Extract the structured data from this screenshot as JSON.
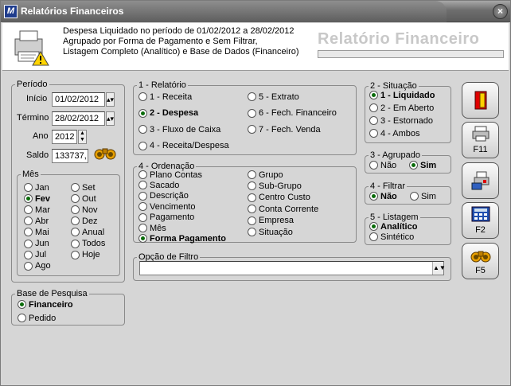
{
  "window": {
    "title": "Relatórios Financeiros",
    "close_label": "×",
    "icon_label": "M"
  },
  "header": {
    "line1": "Despesa Liquidado no período de 01/02/2012 a 28/02/2012",
    "line2": "Agrupado por Forma de Pagamento  e Sem Filtrar,",
    "line3": "Listagem Completo (Analítico) e Base de Dados (Financeiro)",
    "big_title": "Relatório Financeiro"
  },
  "periodo": {
    "legend": "Período",
    "inicio_label": "Início",
    "inicio_value": "01/02/2012",
    "termino_label": "Término",
    "termino_value": "28/02/2012",
    "ano_label": "Ano",
    "ano_value": "2012",
    "saldo_label": "Saldo",
    "saldo_value": "133737,"
  },
  "mes": {
    "legend": "Mês",
    "col1": [
      "Jan",
      "Fev",
      "Mar",
      "Abr",
      "Mai",
      "Jun",
      "Jul",
      "Ago"
    ],
    "col2": [
      "Set",
      "Out",
      "Nov",
      "Dez",
      "Anual",
      "Todos",
      "Hoje"
    ],
    "selected": "Fev"
  },
  "base": {
    "legend": "Base de Pesquisa",
    "options": [
      "Financeiro",
      "Pedido"
    ],
    "selected": "Financeiro"
  },
  "relatorio": {
    "legend": "1 - Relatório",
    "col1": [
      "1 - Receita",
      "2 - Despesa",
      "3 - Fluxo de Caixa",
      "4 - Receita/Despesa"
    ],
    "col2": [
      "5 - Extrato",
      "6 - Fech. Financeiro",
      "7 - Fech. Venda"
    ],
    "selected": "2 - Despesa"
  },
  "ordenacao": {
    "legend": "4 - Ordenação",
    "col1": [
      "Plano Contas",
      "Sacado",
      "Descrição",
      "Vencimento",
      "Pagamento",
      "Mês",
      "Forma Pagamento"
    ],
    "col2": [
      "Grupo",
      "Sub-Grupo",
      "Centro Custo",
      "Conta Corrente",
      "Empresa",
      "Situação"
    ],
    "selected": "Forma Pagamento"
  },
  "filtro": {
    "legend": "Opção de Filtro",
    "value": ""
  },
  "situacao": {
    "legend": "2 - Situação",
    "options": [
      "1 - Liquidado",
      "2 - Em Aberto",
      "3 - Estornado",
      "4 - Ambos"
    ],
    "selected": "1 - Liquidado"
  },
  "agrupado": {
    "legend": "3 - Agrupado",
    "options": [
      "Não",
      "Sim"
    ],
    "selected": "Sim"
  },
  "filtrar": {
    "legend": "4 - Filtrar",
    "options": [
      "Não",
      "Sim"
    ],
    "selected": "Não"
  },
  "listagem": {
    "legend": "5 - Listagem",
    "options": [
      "Analítico",
      "Sintético"
    ],
    "selected": "Analítico"
  },
  "side_buttons": [
    {
      "icon": "exit-door-icon",
      "label": ""
    },
    {
      "icon": "printer-icon",
      "label": "F11"
    },
    {
      "icon": "print-setup-icon",
      "label": ""
    },
    {
      "icon": "calculator-icon",
      "label": "F2"
    },
    {
      "icon": "binoculars-icon",
      "label": "F5"
    }
  ],
  "colors": {
    "radio_dot": "#0a6b0a",
    "title_bar": "#5c5c5c",
    "background": "#d6d6d6"
  }
}
